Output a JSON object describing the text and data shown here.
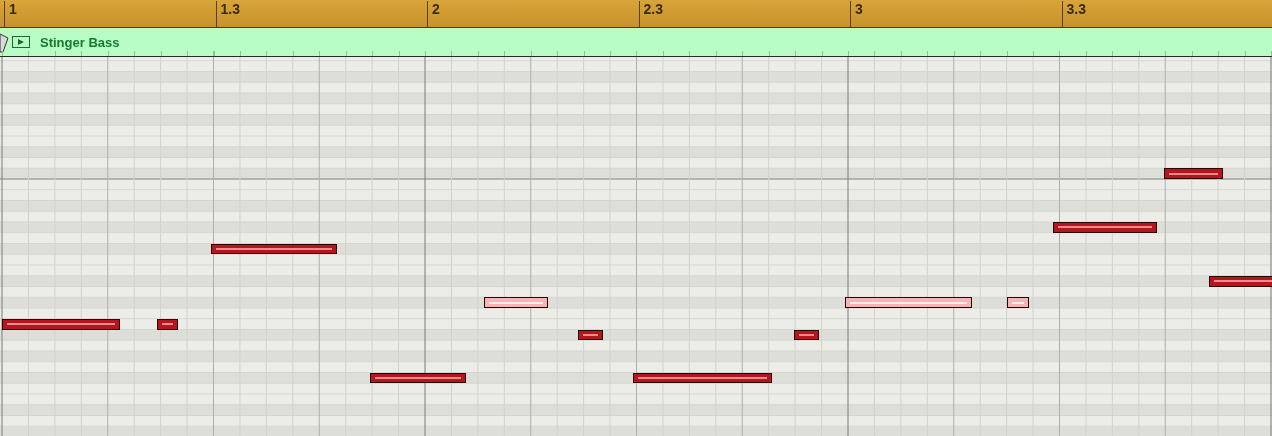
{
  "ruler": {
    "labels": [
      "1",
      "1.3",
      "2",
      "2.3",
      "3",
      "3.3"
    ]
  },
  "region": {
    "name": "Stinger Bass"
  },
  "notes": [
    {
      "selected": false
    },
    {
      "selected": false
    },
    {
      "selected": false
    },
    {
      "selected": false
    },
    {
      "selected": true
    },
    {
      "selected": false
    },
    {
      "selected": false
    },
    {
      "selected": false
    },
    {
      "selected": true
    },
    {
      "selected": true
    },
    {
      "selected": false
    },
    {
      "selected": false
    },
    {
      "selected": false
    }
  ]
}
